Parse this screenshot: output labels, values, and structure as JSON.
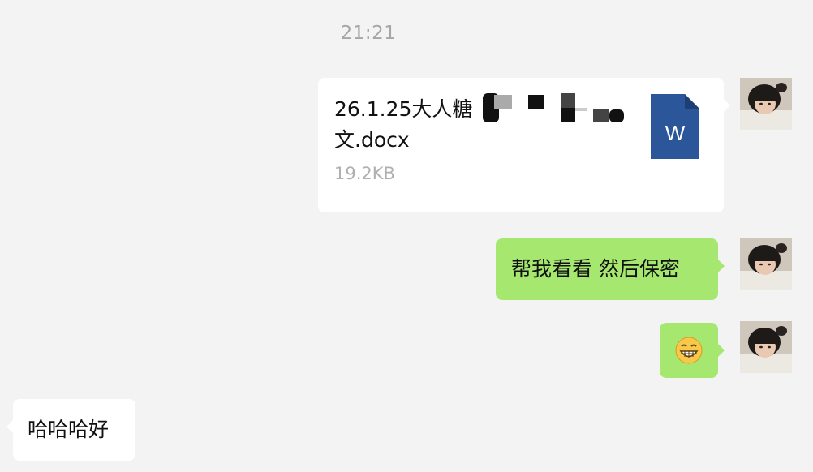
{
  "chat": {
    "timestamp": "21:21",
    "file_message": {
      "file_name": "26.1.25大人糖",
      "file_name_suffix": "文.docx",
      "file_size": "19.2KB",
      "icon": "word-document-icon",
      "icon_letter": "W",
      "icon_color": "#2b579a"
    },
    "text_message_1": "帮我看看 然后保密",
    "emoji_message": "😁",
    "reply_message": "哈哈哈好"
  },
  "colors": {
    "background": "#f3f3f3",
    "sent_bubble": "#a6e86f",
    "received_bubble": "#ffffff",
    "timestamp_text": "#a6a6a6"
  }
}
